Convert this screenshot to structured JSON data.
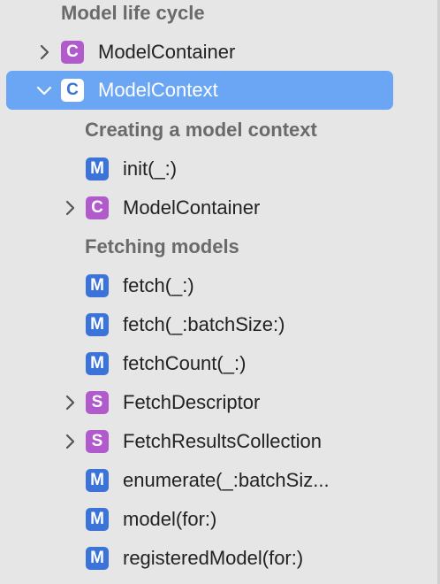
{
  "sidebar": {
    "sections": [
      {
        "header": "Model life cycle",
        "items": [
          {
            "badge": "C",
            "label": "ModelContainer",
            "expanded": false
          },
          {
            "badge": "C",
            "label": "ModelContext",
            "expanded": true,
            "selected": true
          }
        ]
      }
    ],
    "model_context_children": {
      "group1_header": "Creating a model context",
      "group1_items": [
        {
          "badge": "M",
          "label": "init(_:)"
        },
        {
          "badge": "C",
          "label": "ModelContainer"
        }
      ],
      "group2_header": "Fetching models",
      "group2_items": [
        {
          "badge": "M",
          "label": "fetch(_:)"
        },
        {
          "badge": "M",
          "label": "fetch(_:batchSize:)"
        },
        {
          "badge": "M",
          "label": "fetchCount(_:)"
        },
        {
          "badge": "S",
          "label": "FetchDescriptor"
        },
        {
          "badge": "S",
          "label": "FetchResultsCollection"
        },
        {
          "badge": "M",
          "label": "enumerate(_:batchSiz..."
        },
        {
          "badge": "M",
          "label": "model(for:)"
        },
        {
          "badge": "M",
          "label": "registeredModel(for:)"
        }
      ]
    }
  },
  "colors": {
    "background": "#e6e6e6",
    "selected_row": "#6aa6f4",
    "class_badge": "#b05acb",
    "method_badge": "#3b73d9",
    "struct_badge": "#b05acb"
  },
  "icons": {
    "collapsed": "chevron-right-icon",
    "expanded": "chevron-down-icon"
  }
}
